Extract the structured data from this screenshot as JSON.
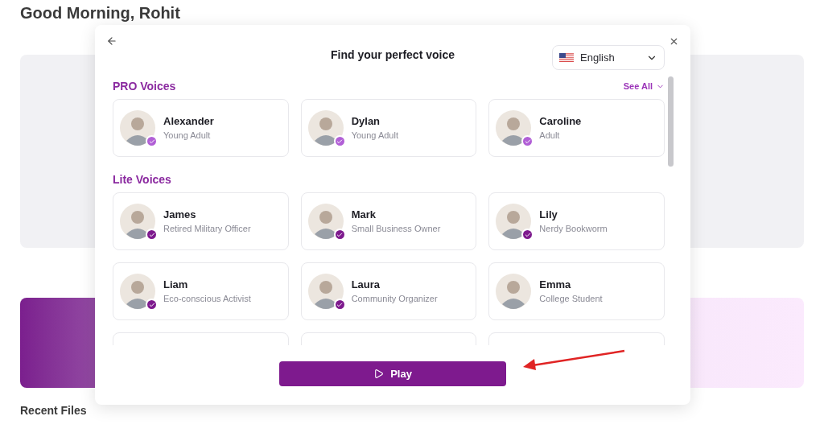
{
  "background": {
    "greeting": "Good Morning, Rohit",
    "recent_files": "Recent Files"
  },
  "dialog": {
    "title": "Find your perfect voice",
    "language": "English",
    "play_button": "Play",
    "sections": [
      {
        "title": "PRO Voices",
        "kind": "pro",
        "see_all": "See All",
        "voices": [
          {
            "name": "Alexander",
            "description": "Young Adult",
            "verified": true
          },
          {
            "name": "Dylan",
            "description": "Young Adult",
            "verified": true
          },
          {
            "name": "Caroline",
            "description": "Adult",
            "verified": true
          }
        ]
      },
      {
        "title": "Lite Voices",
        "kind": "lite",
        "voices": [
          {
            "name": "James",
            "description": "Retired Military Officer",
            "verified": true
          },
          {
            "name": "Mark",
            "description": "Small Business Owner",
            "verified": true
          },
          {
            "name": "Lily",
            "description": "Nerdy Bookworm",
            "verified": true
          },
          {
            "name": "Liam",
            "description": "Eco-conscious Activist",
            "verified": true
          },
          {
            "name": "Laura",
            "description": "Community Organizer",
            "verified": true
          },
          {
            "name": "Emma",
            "description": "College Student",
            "verified": false
          }
        ]
      }
    ]
  }
}
